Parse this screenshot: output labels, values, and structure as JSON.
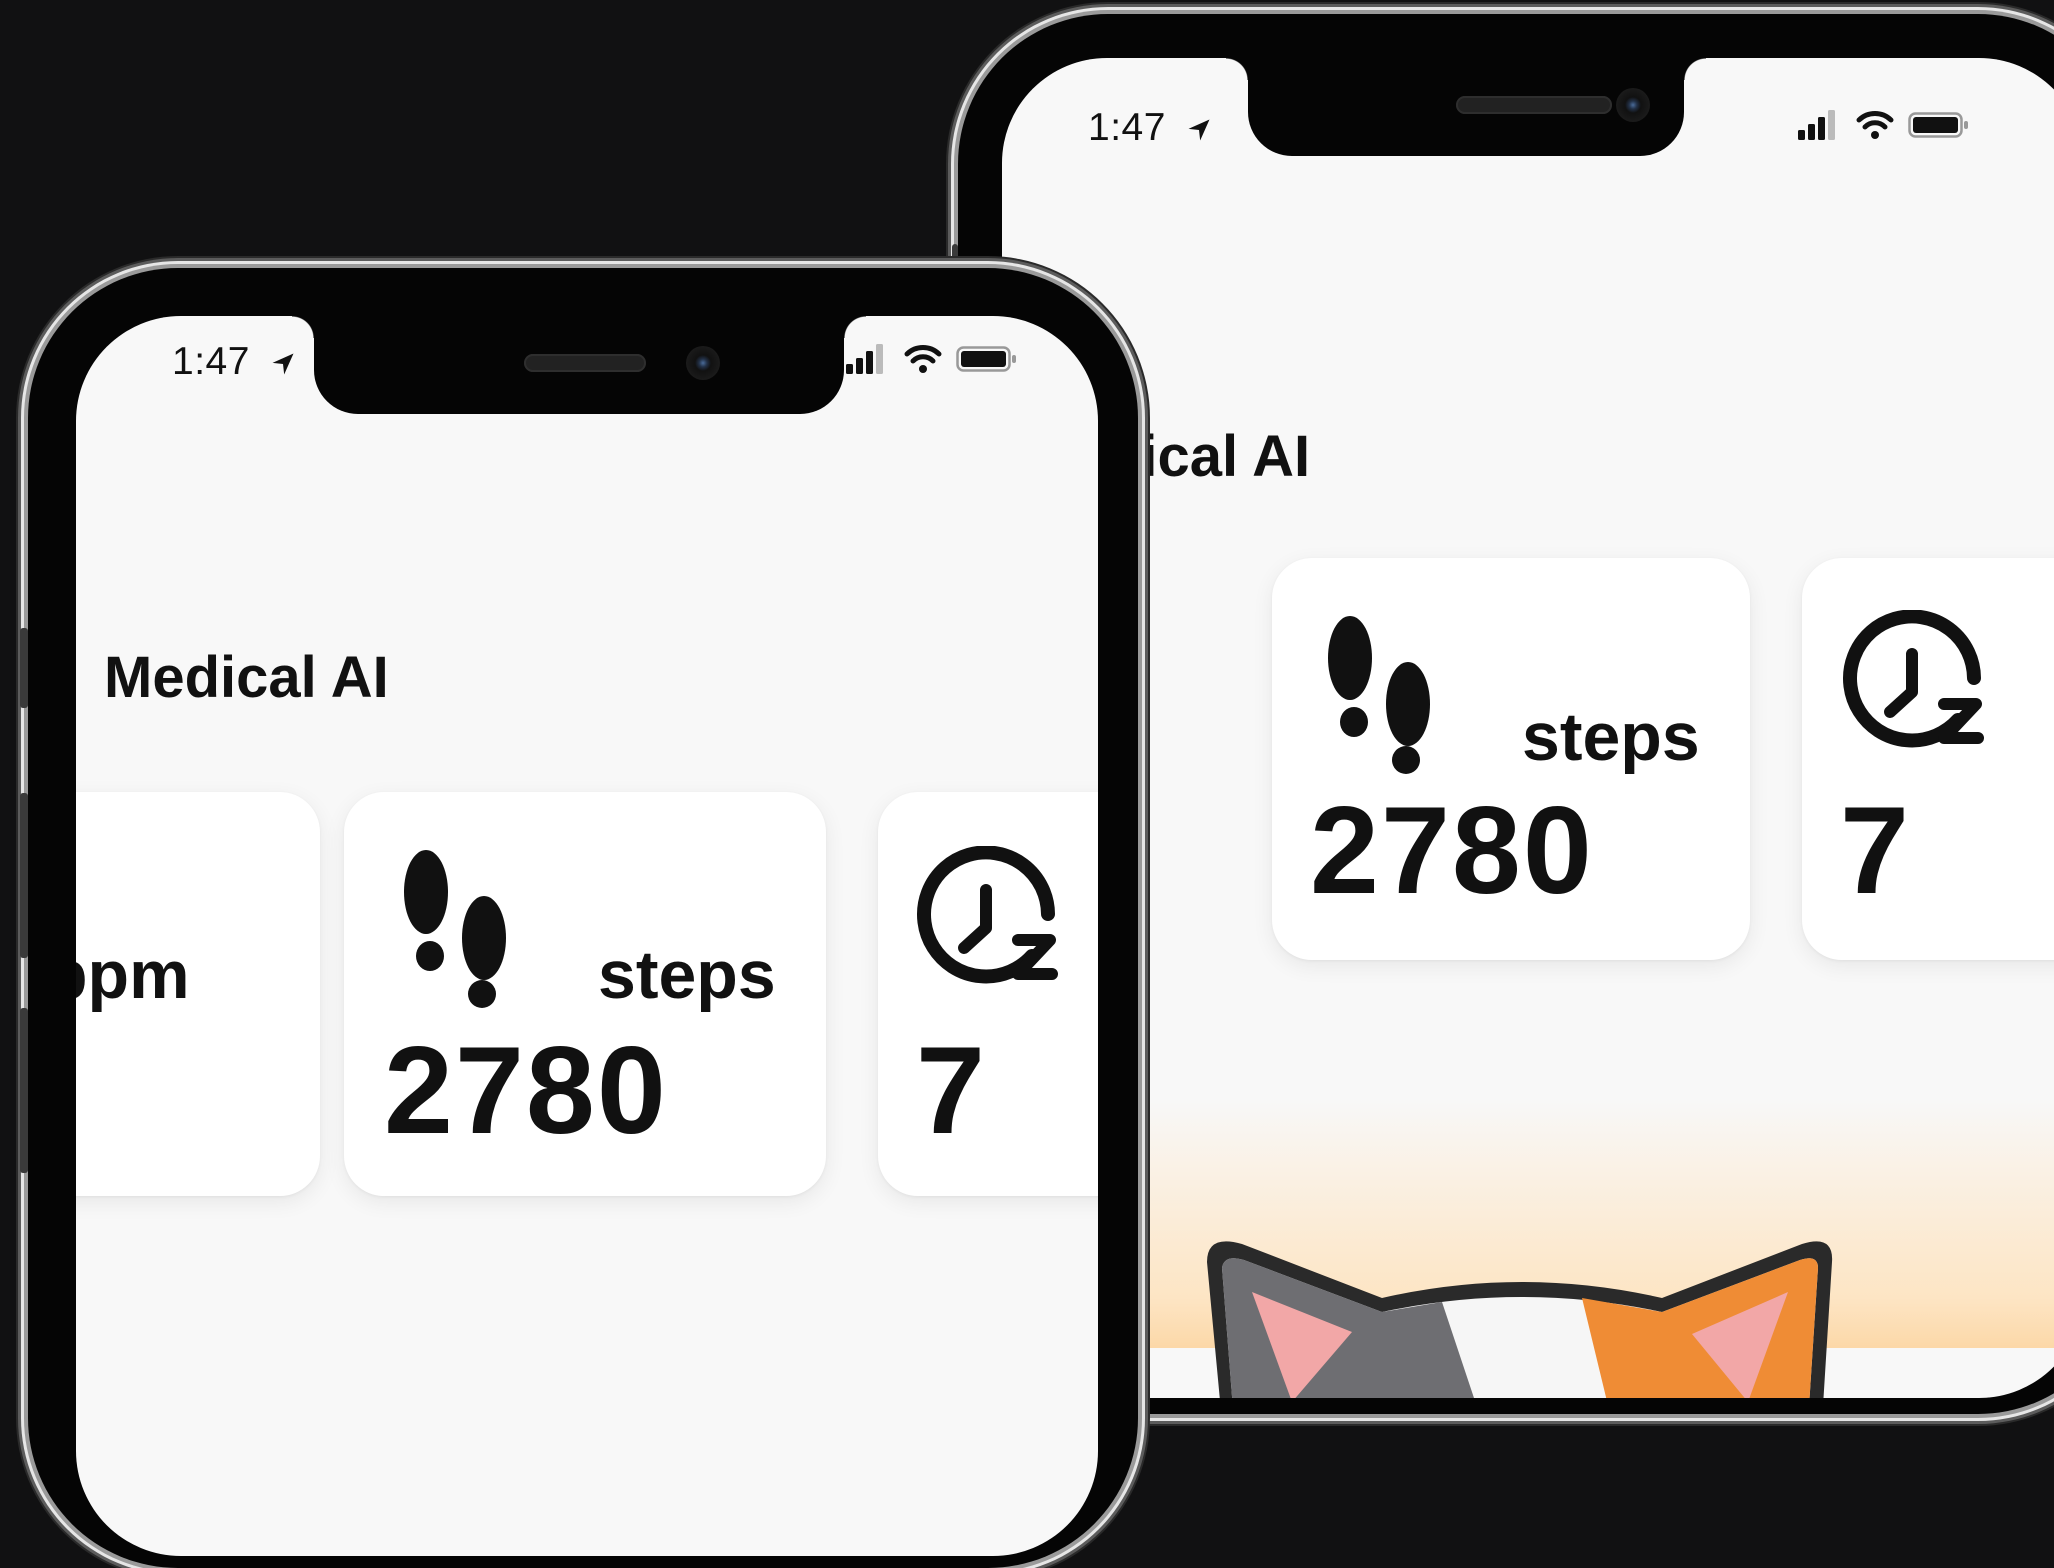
{
  "back_phone": {
    "status_time": "1:47",
    "app_title": "dical AI",
    "cards": [
      {
        "unit": "steps",
        "value": "2780",
        "icon": "footsteps-icon"
      },
      {
        "unit": "",
        "value": "7",
        "icon": "sleep-clock-icon"
      }
    ],
    "illustration": "calico-cat-icon"
  },
  "front_phone": {
    "status_time": "1:47",
    "app_title": "Medical AI",
    "cards": [
      {
        "unit": "bpm",
        "value": ""
      },
      {
        "unit": "steps",
        "value": "2780",
        "icon": "footsteps-icon"
      },
      {
        "unit": "",
        "value": "7",
        "icon": "sleep-clock-icon"
      }
    ]
  },
  "colors": {
    "background": "#111112",
    "screen": "#f8f8f8",
    "card": "#ffffff",
    "text": "#111111",
    "bottom_gradient": "#fcd8a8"
  }
}
